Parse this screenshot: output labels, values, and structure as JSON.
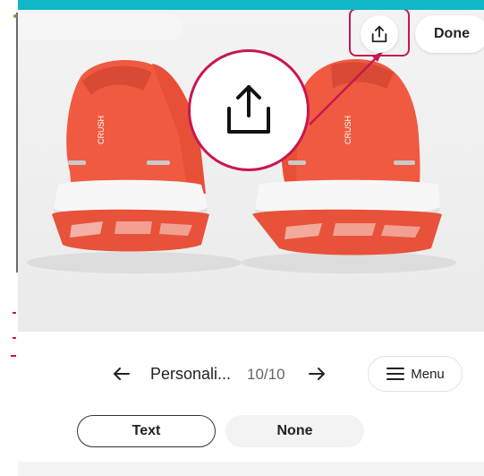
{
  "toolbar": {
    "done_label": "Done",
    "share_icon": "share-upload-icon"
  },
  "product": {
    "side_text_left": "CRUSH",
    "side_text_right": "CRUSH"
  },
  "stepper": {
    "title": "Personali...",
    "progress": "10/10",
    "menu_label": "Menu"
  },
  "options": {
    "items": [
      "Text",
      "None"
    ],
    "selected": "Text"
  },
  "colors": {
    "accent": "#c8174f",
    "brand_strip": "#10b7c6",
    "shoe_upper": "#f05a40",
    "outsole": "#e8523a"
  }
}
